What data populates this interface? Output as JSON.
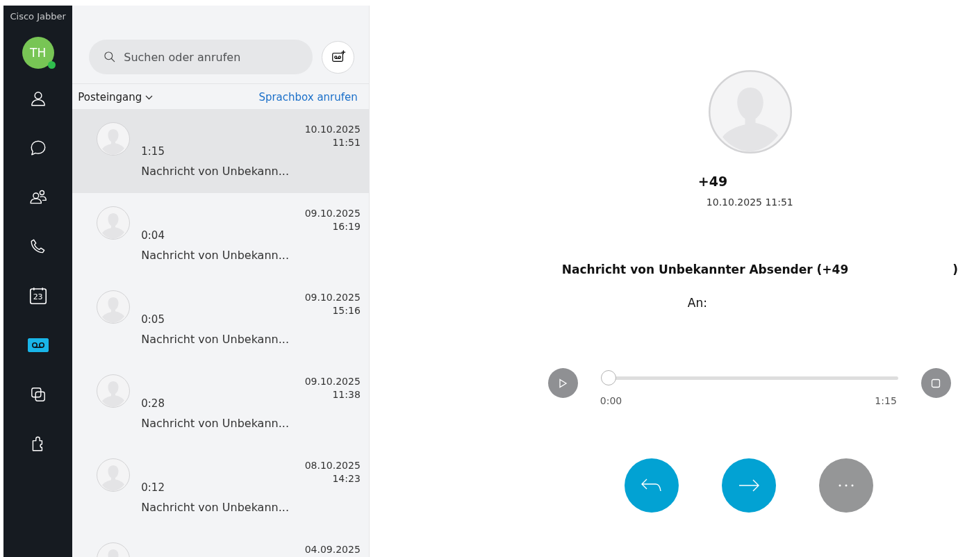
{
  "app": {
    "title": "Cisco Jabber"
  },
  "user": {
    "initials": "TH",
    "online": true
  },
  "nav": [
    {
      "kind": "contacts",
      "selected": false
    },
    {
      "kind": "chat",
      "selected": false
    },
    {
      "kind": "groups",
      "selected": false
    },
    {
      "kind": "phone",
      "selected": false
    },
    {
      "kind": "calendar",
      "label": "23",
      "selected": false
    },
    {
      "kind": "voicemail",
      "selected": true
    },
    {
      "kind": "windows",
      "selected": false
    },
    {
      "kind": "addons",
      "selected": false
    }
  ],
  "search": {
    "placeholder": "Suchen oder anrufen"
  },
  "list_header": {
    "folder": "Posteingang",
    "link": "Sprachbox anrufen"
  },
  "messages": [
    {
      "duration": "1:15",
      "title": "Nachricht von Unbekann...",
      "date": "10.10.2025",
      "time": "11:51",
      "selected": true
    },
    {
      "duration": "0:04",
      "title": "Nachricht von Unbekann...",
      "date": "09.10.2025",
      "time": "16:19",
      "selected": false
    },
    {
      "duration": "0:05",
      "title": "Nachricht von Unbekann...",
      "date": "09.10.2025",
      "time": "15:16",
      "selected": false
    },
    {
      "duration": "0:28",
      "title": "Nachricht von Unbekann...",
      "date": "09.10.2025",
      "time": "11:38",
      "selected": false
    },
    {
      "duration": "0:12",
      "title": "Nachricht von Unbekann...",
      "date": "08.10.2025",
      "time": "14:23",
      "selected": false
    },
    {
      "date": "04.09.2025",
      "selected": false
    }
  ],
  "detail": {
    "caller": "+49",
    "datetime": "10.10.2025 11:51",
    "subject": "Nachricht von Unbekannter Absender (+49",
    "subject_end": ")",
    "to_label": "An:",
    "player": {
      "level": 0,
      "start": "0:00",
      "end": "1:15"
    }
  }
}
